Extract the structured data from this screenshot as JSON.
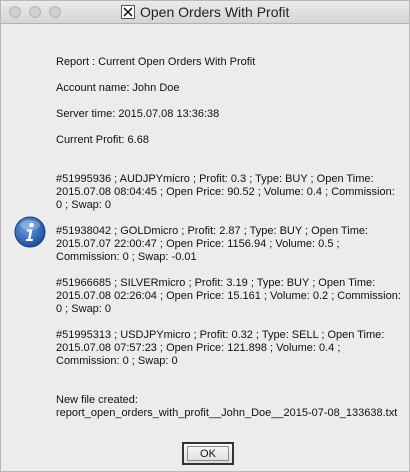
{
  "window": {
    "title": "Open Orders With Profit"
  },
  "message": {
    "report": "Report : Current Open Orders With Profit",
    "account": "Account name: John Doe",
    "server_time": "Server time: 2015.07.08 13:36:38",
    "current_profit": "Current Profit: 6.68",
    "orders": [
      "#51995936 ; AUDJPYmicro ; Profit: 0.3 ; Type: BUY ; Open Time: 2015.07.08 08:04:45 ; Open Price: 90.52 ; Volume: 0.4 ; Commission: 0 ; Swap: 0",
      "#51938042 ; GOLDmicro ; Profit: 2.87 ; Type: BUY ; Open Time: 2015.07.07 22:00:47 ; Open Price: 1156.94 ; Volume: 0.5 ; Commission: 0 ; Swap: -0.01",
      "#51966685 ; SILVERmicro ; Profit: 3.19 ; Type: BUY ; Open Time: 2015.07.08 02:26:04 ; Open Price: 15.161 ; Volume: 0.2 ; Commission: 0 ; Swap: 0",
      "#51995313 ; USDJPYmicro ; Profit: 0.32 ; Type: SELL ; Open Time: 2015.07.08 07:57:23 ; Open Price: 121.898 ; Volume: 0.4 ; Commission: 0 ; Swap: 0"
    ],
    "new_file_label": "New file created:",
    "new_file_name": "report_open_orders_with_profit__John_Doe__2015-07-08_133638.txt"
  },
  "buttons": {
    "ok_label": "OK"
  },
  "icons": {
    "info": "info-icon",
    "app": "x-window-icon"
  }
}
